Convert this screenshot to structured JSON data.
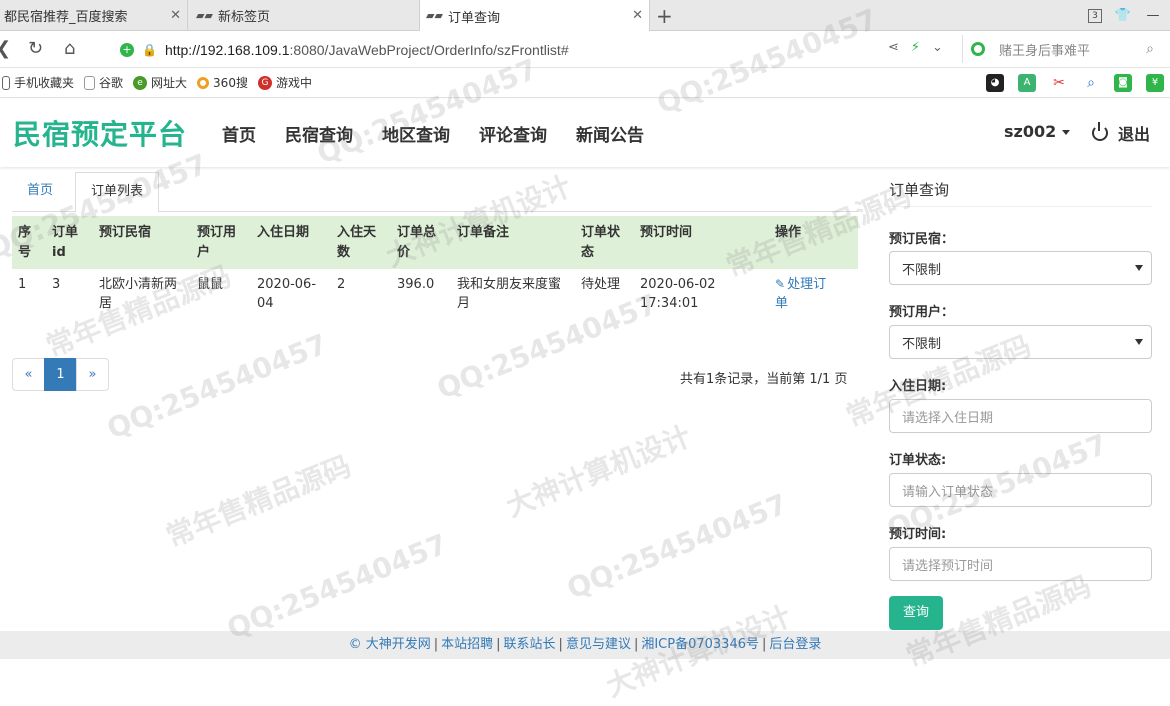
{
  "browser": {
    "tabs": [
      {
        "title": "都民宿推荐_百度搜索"
      },
      {
        "title": "新标签页"
      },
      {
        "title": "订单查询"
      }
    ],
    "tab_count": "3",
    "url": "http://192.168.109.1:8080/JavaWebProject/OrderInfo/szFrontlist#",
    "url_host": "http://192.168.109.1",
    "url_rest": ":8080/JavaWebProject/OrderInfo/szFrontlist#",
    "search_placeholder": "赌王身后事难平",
    "bookmarks": [
      "手机收藏夹",
      "谷歌",
      "网址大",
      "360搜",
      "游戏中"
    ]
  },
  "header": {
    "brand": "民宿预定平台",
    "nav": [
      "首页",
      "民宿查询",
      "地区查询",
      "评论查询",
      "新闻公告"
    ],
    "user": "sz002",
    "logout": "退出"
  },
  "breadcrumb": {
    "home": "首页",
    "current": "订单列表"
  },
  "table": {
    "headers": [
      [
        "序",
        "号"
      ],
      [
        "订单",
        "id"
      ],
      [
        "预订民宿"
      ],
      [
        "预订用",
        "户"
      ],
      [
        "入住日期"
      ],
      [
        "入住天",
        "数"
      ],
      [
        "订单总",
        "价"
      ],
      [
        "订单备注"
      ],
      [
        "订单状",
        "态"
      ],
      [
        "预订时间"
      ],
      [
        "操作"
      ]
    ],
    "rows": [
      {
        "no": "1",
        "id": "3",
        "homestay": [
          "北欧小清新两",
          "居"
        ],
        "user": "鼠鼠",
        "checkin": [
          "2020-06-",
          "04"
        ],
        "days": "2",
        "total": "396.0",
        "remark": [
          "我和女朋友来度蜜",
          "月"
        ],
        "status": "待处理",
        "booked_at": [
          "2020-06-02",
          "17:34:01"
        ],
        "action": [
          "处理订",
          "单"
        ]
      }
    ]
  },
  "pagination": {
    "prev": "«",
    "current": "1",
    "next": "»",
    "info": "共有1条记录，当前第 1/1 页"
  },
  "sidebar": {
    "title": "订单查询",
    "fields": [
      {
        "label": "预订民宿：",
        "type": "select",
        "value": "不限制"
      },
      {
        "label": "预订用户：",
        "type": "select",
        "value": "不限制"
      },
      {
        "label": "入住日期:",
        "type": "input",
        "placeholder": "请选择入住日期"
      },
      {
        "label": "订单状态:",
        "type": "input",
        "placeholder": "请输入订单状态"
      },
      {
        "label": "预订时间:",
        "type": "input",
        "placeholder": "请选择预订时间"
      }
    ],
    "submit": "查询"
  },
  "footer": {
    "links": [
      "© 大神开发网",
      "本站招聘",
      "联系站长",
      "意见与建议",
      "湘ICP备0703346号",
      "后台登录"
    ]
  },
  "watermarks": [
    "QQ:254540457",
    "大神计算机设计",
    "常年售精品源码"
  ]
}
